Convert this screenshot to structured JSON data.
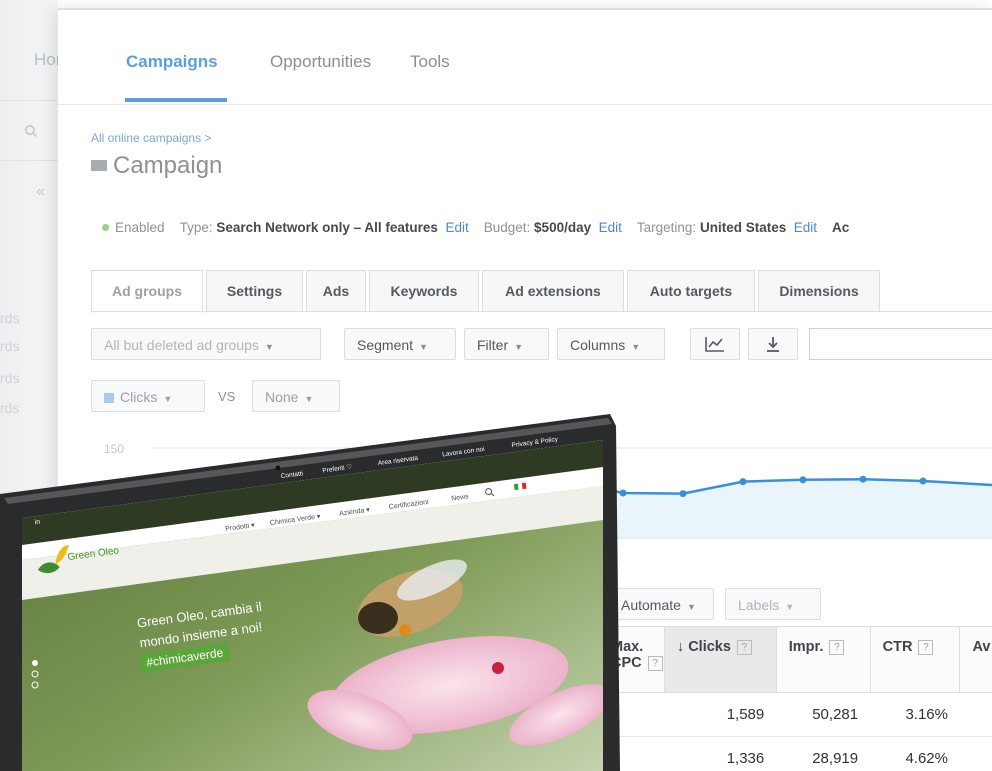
{
  "left_sidebar": {
    "home_label": "Home",
    "words": [
      "rds",
      "rds",
      "rds",
      "rds"
    ]
  },
  "topnav": {
    "tabs": [
      {
        "label": "Campaigns",
        "active": true
      },
      {
        "label": "Opportunities"
      },
      {
        "label": "Tools"
      }
    ]
  },
  "breadcrumb": "All online campaigns >",
  "page_title": "Campaign",
  "status": {
    "state": "Enabled",
    "type_label": "Type:",
    "type_value": "Search Network only – All features",
    "edit": "Edit",
    "budget_label": "Budget:",
    "budget_value": "$500/day",
    "targeting_label": "Targeting:",
    "targeting_value": "United States",
    "trailing": "Ac"
  },
  "tabs": [
    "Ad groups",
    "Settings",
    "Ads",
    "Keywords",
    "Ad extensions",
    "Auto targets",
    "Dimensions"
  ],
  "toolbar": {
    "filter_status": "All but deleted ad groups",
    "segment": "Segment",
    "filter": "Filter",
    "columns": "Columns",
    "chart_icon": "line-chart-icon",
    "download_icon": "download-icon"
  },
  "metric_selector": {
    "metric": "Clicks",
    "vs": "VS",
    "compare": "None"
  },
  "chart_data": {
    "type": "line",
    "y_max_label": "150",
    "series": [
      {
        "values": [
          95,
          75,
          74,
          94,
          97,
          98,
          95
        ]
      }
    ],
    "ylim": [
      0,
      150
    ],
    "fill_color": "#e9f4fb",
    "line_color": "#3a8fd9"
  },
  "table_toolbar": {
    "automate": "Automate",
    "labels": "Labels"
  },
  "table": {
    "headers": [
      "Max. CPC",
      "Clicks",
      "Impr.",
      "CTR",
      "Av"
    ],
    "sorted_arrow": "↓",
    "help": "?",
    "rows": [
      [
        "1,589",
        "50,281",
        "3.16%"
      ],
      [
        "1,336",
        "28,919",
        "4.62%"
      ]
    ]
  },
  "tablet_site": {
    "topbar": [
      "Contatti",
      "Preferiti ♡",
      "Area riservata",
      "Lavora con noi",
      "Privacy & Policy"
    ],
    "side_label": "in",
    "logo_text": "Green Oleo",
    "menu": [
      "Prodotti ▾",
      "Chimica Verde ▾",
      "Azienda ▾",
      "Certificazioni",
      "News"
    ],
    "search_icon": "search-icon",
    "flag": "italian-flag-icon",
    "hero_title_line1": "Green Oleo, cambia il",
    "hero_title_line2": "mondo insieme a noi!",
    "hashtag": "#chimicaverde",
    "colors": {
      "brand_green": "#5aa63a",
      "hero_dark": "#3d5a25"
    }
  }
}
